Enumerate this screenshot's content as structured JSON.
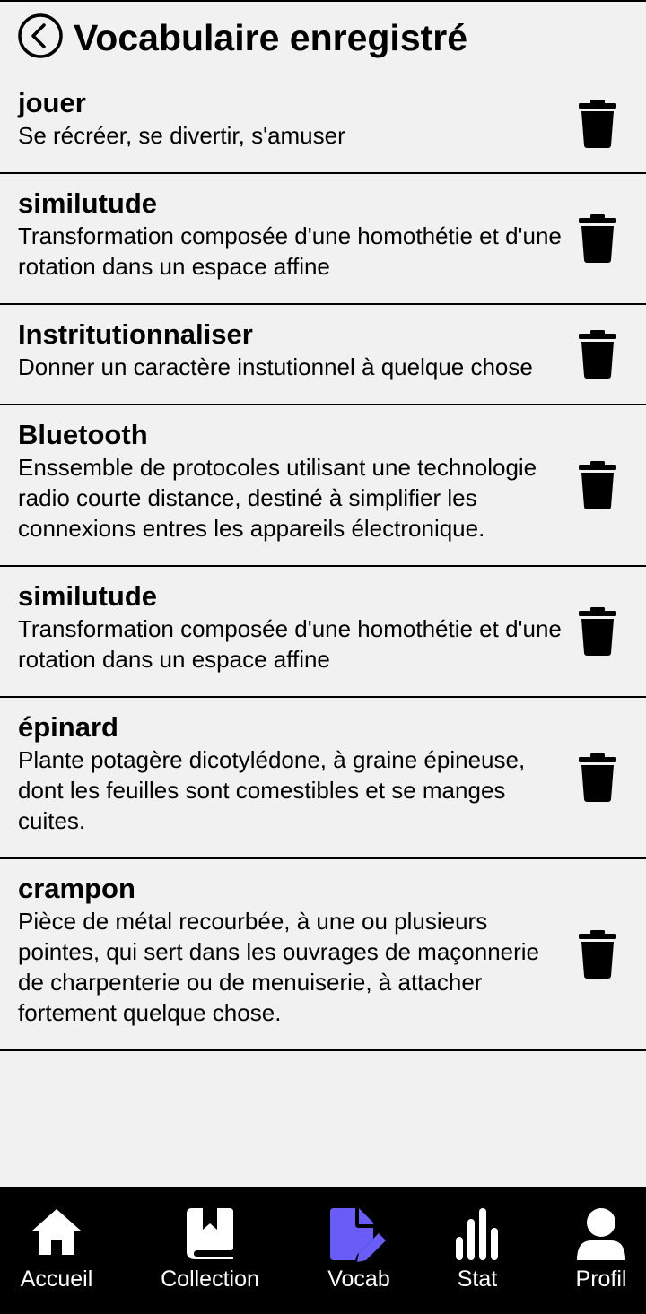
{
  "header": {
    "title": "Vocabulaire enregistré",
    "back_icon": "chevron-left-circle-icon"
  },
  "entries": [
    {
      "word": "jouer",
      "definition": "Se récréer, se divertir, s'amuser"
    },
    {
      "word": "similutude",
      "definition": "Transformation composée d'une homothétie et d'une rotation dans un espace affine"
    },
    {
      "word": "Instritutionnaliser",
      "definition": "Donner un caractère instutionnel à quelque chose"
    },
    {
      "word": "Bluetooth",
      "definition": "Enssemble de protocoles utilisant une technologie radio courte distance, destiné à simplifier les connexions entres les appareils électronique."
    },
    {
      "word": "similutude",
      "definition": "Transformation composée d'une homothétie et d'une rotation dans un espace affine"
    },
    {
      "word": "épinard",
      "definition": "Plante potagère dicotylédone, à graine épineuse, dont les feuilles sont comestibles et se manges cuites."
    },
    {
      "word": "crampon",
      "definition": "Pièce de métal recourbée, à une ou plusieurs pointes, qui sert dans les ouvrages de maçonnerie de charpenterie ou de menuiserie, à attacher fortement quelque chose."
    }
  ],
  "nav": {
    "items": [
      {
        "label": "Accueil",
        "icon": "home-icon",
        "active": false
      },
      {
        "label": "Collection",
        "icon": "book-icon",
        "active": false
      },
      {
        "label": "Vocab",
        "icon": "file-edit-icon",
        "active": true
      },
      {
        "label": "Stat",
        "icon": "bar-chart-icon",
        "active": false
      },
      {
        "label": "Profil",
        "icon": "user-icon",
        "active": false
      }
    ]
  },
  "colors": {
    "background": "#f1f1f1",
    "nav_background": "#000000",
    "active_icon": "#6a5cf6",
    "text": "#000000"
  }
}
